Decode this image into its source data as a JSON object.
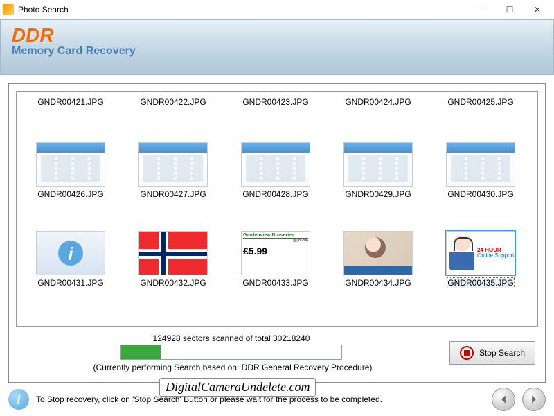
{
  "window": {
    "title": "Photo Search"
  },
  "header": {
    "logo": "DDR",
    "subtitle": "Memory Card Recovery"
  },
  "files_top": [
    {
      "name": "GNDR00421.JPG"
    },
    {
      "name": "GNDR00422.JPG"
    },
    {
      "name": "GNDR00423.JPG"
    },
    {
      "name": "GNDR00424.JPG"
    },
    {
      "name": "GNDR00425.JPG"
    }
  ],
  "files_mid": [
    {
      "name": "GNDR00426.JPG"
    },
    {
      "name": "GNDR00427.JPG"
    },
    {
      "name": "GNDR00428.JPG"
    },
    {
      "name": "GNDR00429.JPG"
    },
    {
      "name": "GNDR00430.JPG"
    }
  ],
  "files_bot": [
    {
      "name": "GNDR00431.JPG",
      "thumb": "info"
    },
    {
      "name": "GNDR00432.JPG",
      "thumb": "flag"
    },
    {
      "name": "GNDR00433.JPG",
      "thumb": "card"
    },
    {
      "name": "GNDR00434.JPG",
      "thumb": "photo"
    },
    {
      "name": "GNDR00435.JPG",
      "thumb": "support",
      "selected": true
    }
  ],
  "card": {
    "title": "Gardenview Nurseries",
    "price": "£5.99",
    "code": "86706"
  },
  "support": {
    "line1": "24 HOUR",
    "line2": "Online Support"
  },
  "status": {
    "sectors_text": "124928 sectors scanned of total 30218240",
    "sectors_scanned": 124928,
    "sectors_total": 30218240,
    "procedure_text": "(Currently performing Search based on:  DDR General Recovery Procedure)"
  },
  "buttons": {
    "stop": "Stop Search"
  },
  "footer": {
    "hint": "To Stop recovery, click on 'Stop Search' Button or please wait for the process to be completed."
  },
  "watermark": "DigitalCameraUndelete.com"
}
